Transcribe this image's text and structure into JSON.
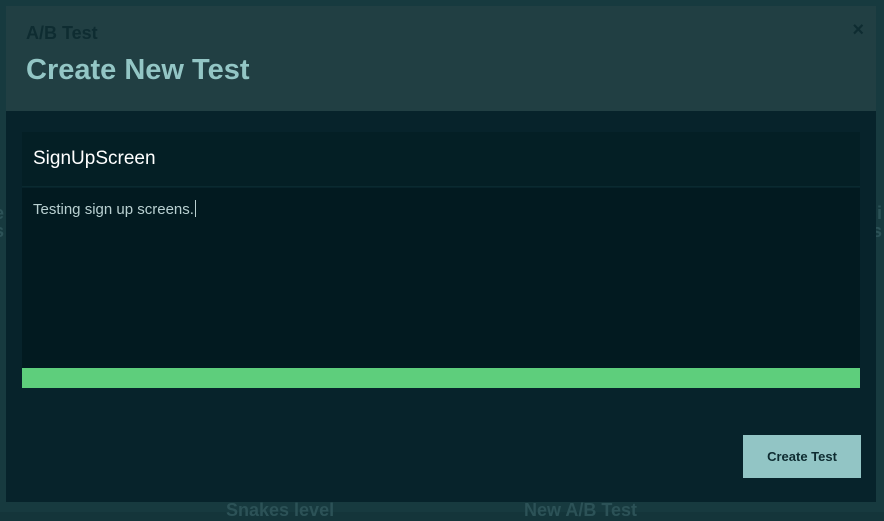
{
  "background": {
    "left_fragment": "e\ns",
    "right_fragment": "li\ns",
    "bottom_item_1": "Snakes level",
    "bottom_item_2": "New A/B Test"
  },
  "modal": {
    "subtitle": "A/B Test",
    "title": "Create New Test",
    "close_icon": "×"
  },
  "form": {
    "name_value": "SignUpScreen",
    "description_value": "Testing sign up screens."
  },
  "actions": {
    "create_label": "Create Test"
  },
  "colors": {
    "accent": "#5ece7c",
    "title": "#93c6c5",
    "button": "#92c5c5"
  }
}
